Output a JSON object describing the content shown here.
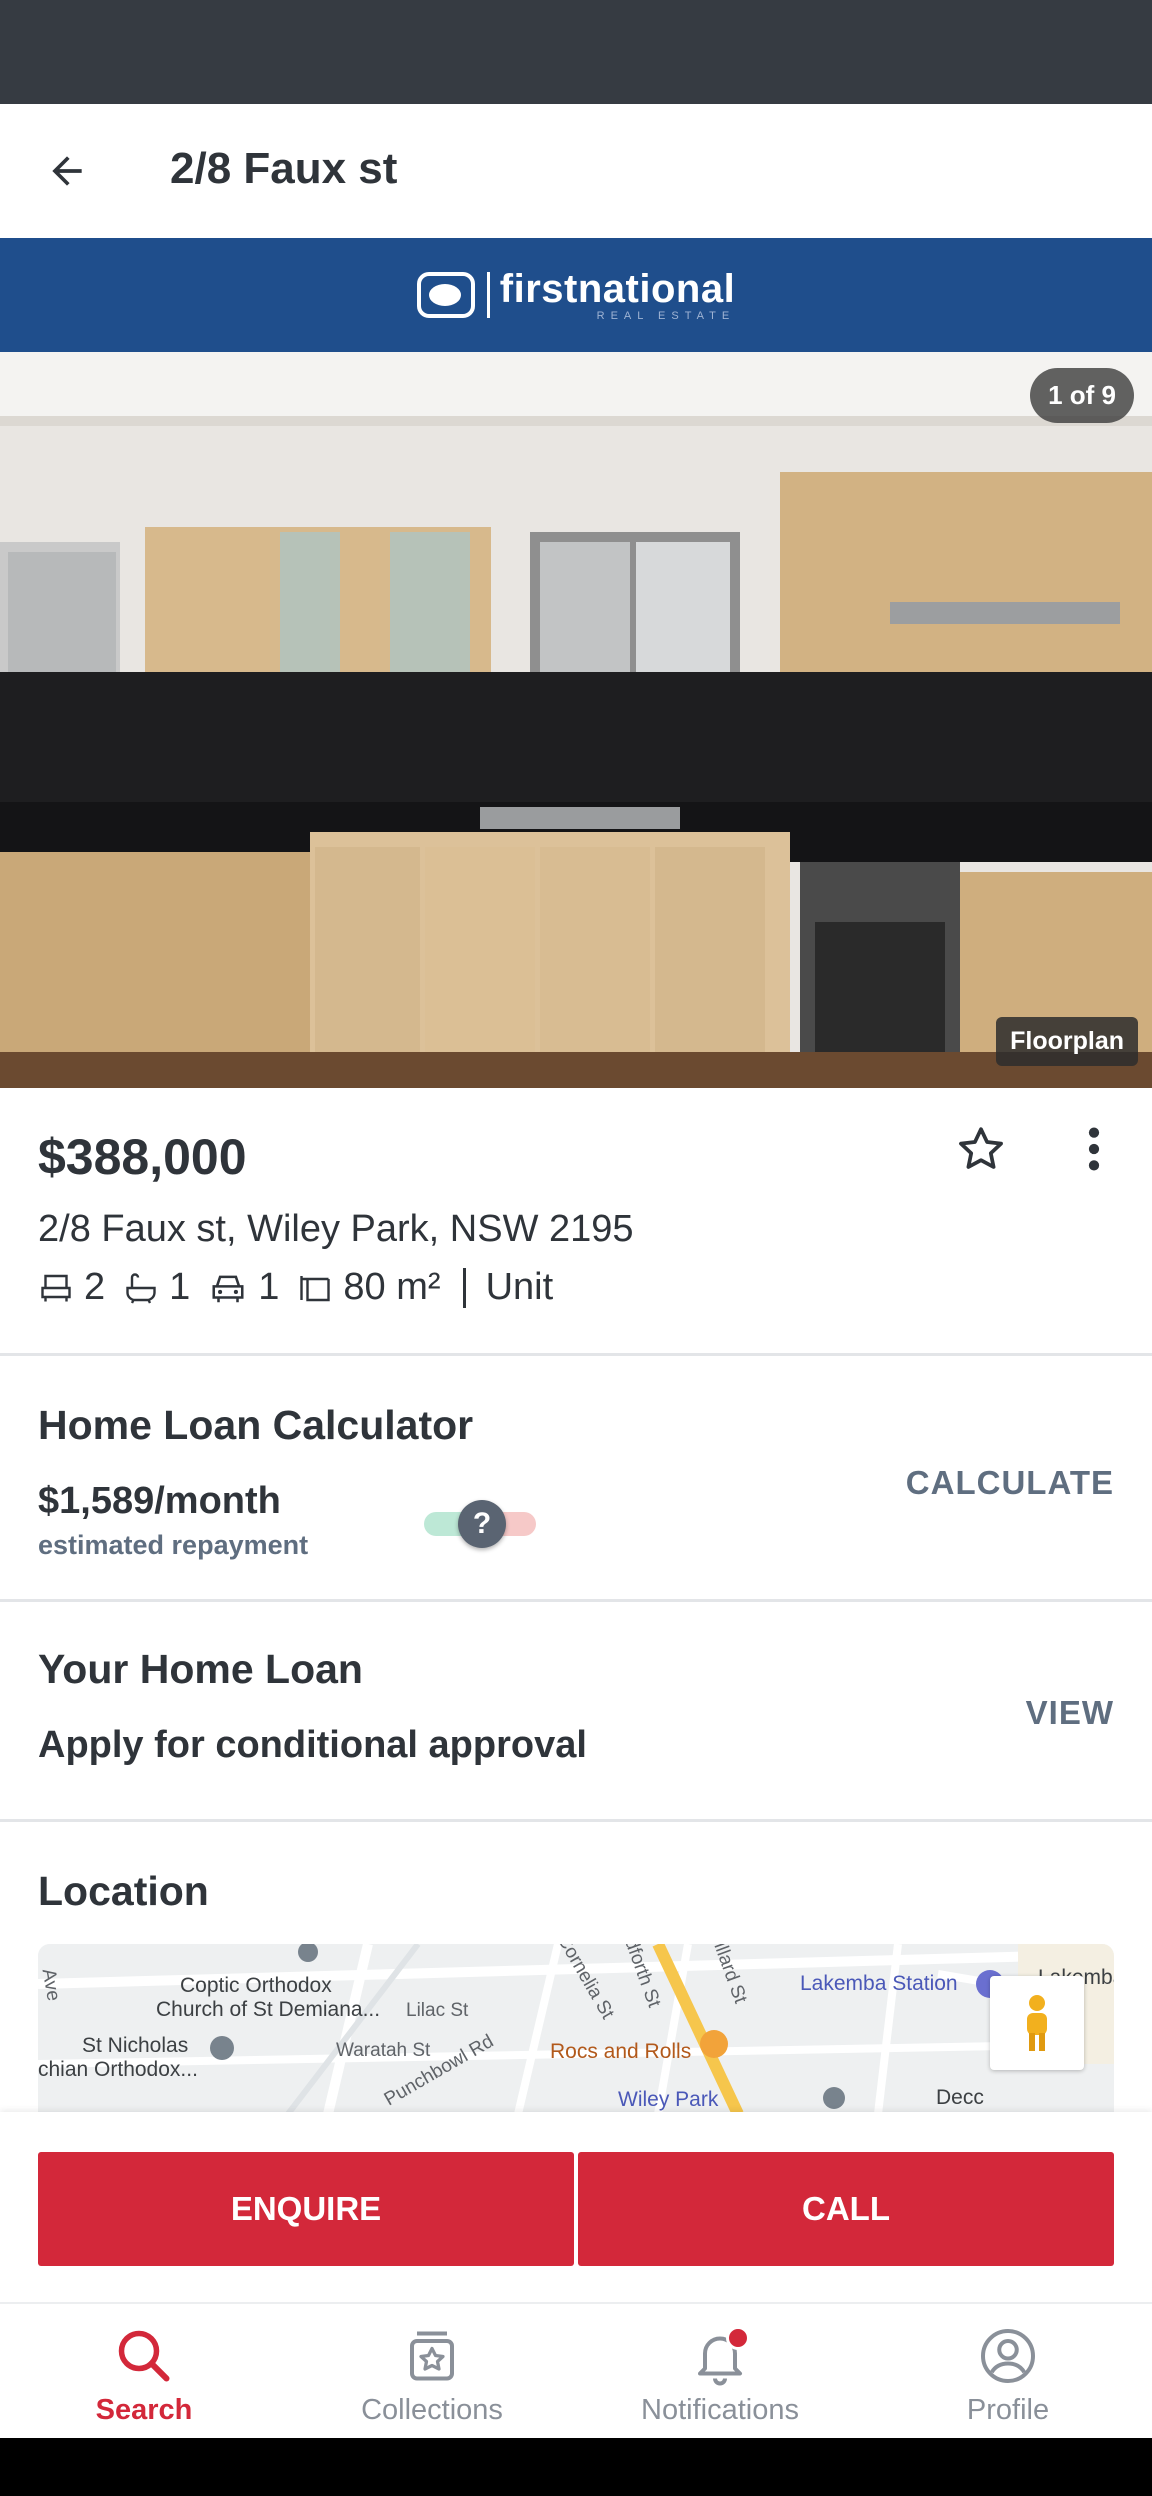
{
  "header": {
    "title": "2/8 Faux st"
  },
  "brand": {
    "name": "firstnational",
    "sub": "REAL ESTATE",
    "color": "#1f4e8c"
  },
  "gallery": {
    "counter": "1 of 9",
    "floorplan_label": "Floorplan"
  },
  "listing": {
    "price": "$388,000",
    "address": "2/8 Faux st, Wiley Park, NSW 2195",
    "beds": "2",
    "baths": "1",
    "cars": "1",
    "area": "80 m²",
    "property_type": "Unit"
  },
  "calculator": {
    "title": "Home Loan Calculator",
    "amount": "$1,589/month",
    "sub": "estimated repayment",
    "toggle_symbol": "?",
    "action": "CALCULATE"
  },
  "home_loan": {
    "title": "Your Home Loan",
    "sub": "Apply for conditional approval",
    "action": "VIEW"
  },
  "location": {
    "title": "Location",
    "map_labels": {
      "coptic_1": "Coptic Orthodox",
      "coptic_2": "Church of St Demiana...",
      "nicholas_1": "St Nicholas",
      "nicholas_2": "chian Orthodox...",
      "lakemba": "Lakemba Station",
      "lakemba_cut": "Lakemba",
      "rocs": "Rocs and Rolls",
      "wiley": "Wiley Park",
      "decc": "Decc",
      "lilac": "Lilac St",
      "waratah": "Waratah St",
      "punchbowl": "Punchbowl Rd",
      "cornelia": "Cornelia St",
      "dforth": "dforth St",
      "illard": "illard St",
      "ave": "Ave"
    }
  },
  "actions": {
    "enquire": "ENQUIRE",
    "call": "CALL",
    "accent": "#d3283a"
  },
  "nav": {
    "search": "Search",
    "collections": "Collections",
    "notifications": "Notifications",
    "profile": "Profile"
  }
}
